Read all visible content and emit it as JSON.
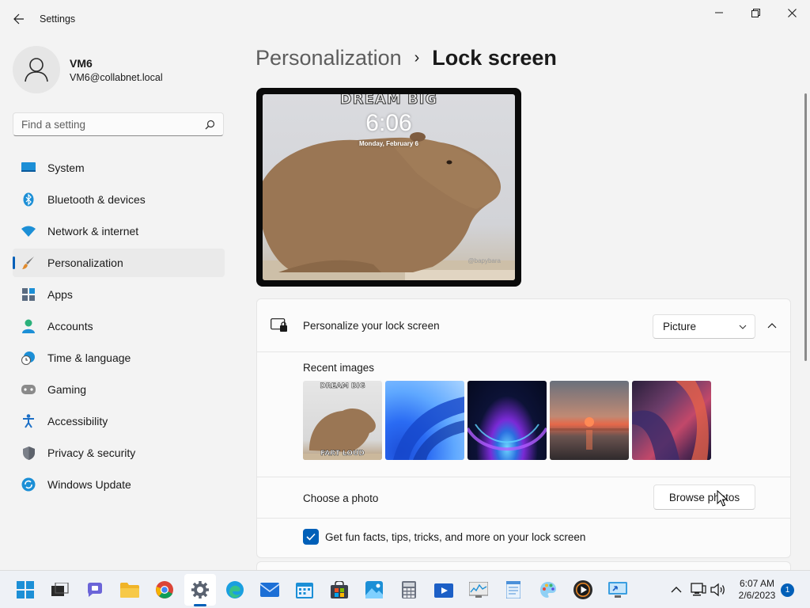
{
  "window": {
    "title": "Settings"
  },
  "profile": {
    "name": "VM6",
    "email": "VM6@collabnet.local"
  },
  "search": {
    "placeholder": "Find a setting"
  },
  "sidebar": {
    "items": [
      {
        "label": "System",
        "icon": "system-icon"
      },
      {
        "label": "Bluetooth & devices",
        "icon": "bluetooth-icon"
      },
      {
        "label": "Network & internet",
        "icon": "wifi-icon"
      },
      {
        "label": "Personalization",
        "icon": "brush-icon",
        "active": true
      },
      {
        "label": "Apps",
        "icon": "apps-icon"
      },
      {
        "label": "Accounts",
        "icon": "accounts-icon"
      },
      {
        "label": "Time & language",
        "icon": "clock-globe-icon"
      },
      {
        "label": "Gaming",
        "icon": "gamepad-icon"
      },
      {
        "label": "Accessibility",
        "icon": "accessibility-icon"
      },
      {
        "label": "Privacy & security",
        "icon": "shield-icon"
      },
      {
        "label": "Windows Update",
        "icon": "update-icon"
      }
    ]
  },
  "breadcrumb": {
    "parent": "Personalization",
    "separator": "›",
    "current": "Lock screen"
  },
  "preview": {
    "meme_text": "DREAM BIG",
    "time": "6:06",
    "date": "Monday, February 6",
    "credit": "@bapybara"
  },
  "lock_settings": {
    "personalize_label": "Personalize your lock screen",
    "mode_value": "Picture",
    "recent_label": "Recent images",
    "thumb1_top": "DREAM BIG",
    "thumb1_bottom": "FART LOUD",
    "choose_label": "Choose a photo",
    "browse_label": "Browse photos",
    "tips_label": "Get fun facts, tips, tricks, and more on your lock screen",
    "tips_checked": true
  },
  "taskbar": {
    "apps": [
      "start",
      "task-view",
      "teams",
      "file-explorer",
      "chrome",
      "settings",
      "edge",
      "mail",
      "calendar",
      "store",
      "photos",
      "calculator",
      "movies",
      "performance-monitor",
      "notepad",
      "paint",
      "media-player",
      "remote-desktop"
    ],
    "time": "6:07 AM",
    "date": "2/6/2023",
    "notification_count": "1"
  },
  "colors": {
    "accent": "#005fb8",
    "background": "#f3f3f3",
    "card": "#fbfbfb"
  }
}
